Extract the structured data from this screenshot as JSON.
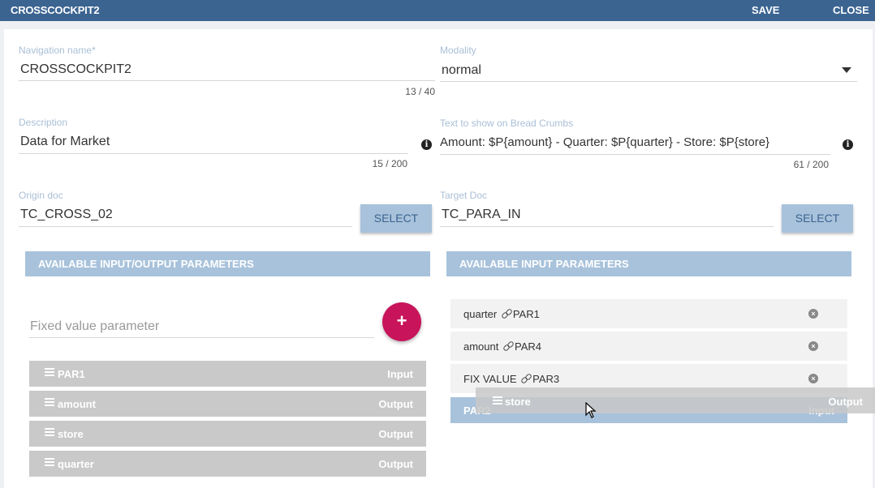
{
  "window": {
    "title": "CROSSCOCKPIT2",
    "save_label": "SAVE",
    "close_label": "CLOSE"
  },
  "form": {
    "navigation_name": {
      "label": "Navigation name",
      "required_mark": "*",
      "value": "CROSSCOCKPIT2",
      "counter": "13 / 40"
    },
    "modality": {
      "label": "Modality",
      "value": "normal"
    },
    "description": {
      "label": "Description",
      "value": "Data for Market",
      "counter": "15 / 200"
    },
    "breadcrumbs": {
      "label": "Text to show on Bread Crumbs",
      "value": "Amount: $P{amount} - Quarter: $P{quarter} - Store: $P{store}",
      "counter": "61 / 200"
    },
    "origin_doc": {
      "label": "Origin doc",
      "value": "TC_CROSS_02",
      "select_label": "SELECT"
    },
    "target_doc": {
      "label": "Target Doc",
      "value": "TC_PARA_IN",
      "select_label": "SELECT"
    }
  },
  "output_panel": {
    "header": "AVAILABLE INPUT/OUTPUT PARAMETERS",
    "fixed_value_placeholder": "Fixed value parameter",
    "add_icon": "plus",
    "params": [
      {
        "name": "PAR1",
        "kind": "Input"
      },
      {
        "name": "amount",
        "kind": "Output"
      },
      {
        "name": "store",
        "kind": "Output"
      },
      {
        "name": "quarter",
        "kind": "Output"
      }
    ]
  },
  "input_panel": {
    "header": "AVAILABLE INPUT PARAMETERS",
    "links": [
      {
        "source": "quarter",
        "target": "PAR1"
      },
      {
        "source": "amount",
        "target": "PAR4"
      },
      {
        "source": "FIX VALUE",
        "target": "PAR3"
      }
    ],
    "drop_target": {
      "name": "PAR2",
      "kind": "Input"
    }
  },
  "drag_item": {
    "name": "store",
    "kind": "Output"
  },
  "colors": {
    "topbar": "#3b6491",
    "accent_light": "#a8c2db",
    "fab": "#c8145a",
    "param_row": "#c9c9c9"
  }
}
